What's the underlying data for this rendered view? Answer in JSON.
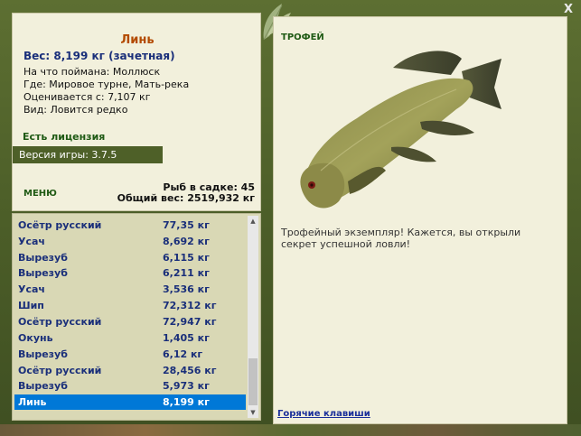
{
  "fish_card": {
    "name": "Линь",
    "weight_line": "Вес: 8,199 кг (зачетная)",
    "caught_on": "На что поймана: Моллюск",
    "location": "Где: Мировое турне, Мать-река",
    "valued_from": "Оценивается с: 7,107 кг",
    "kind": "Вид: Ловится редко",
    "license": "Есть лицензия",
    "version": "Версия игры: 3.7.5"
  },
  "menu": {
    "label": "МЕНЮ"
  },
  "keepnet": {
    "count_text": "Рыб в садке: 45",
    "total_text": "Общий вес: 2519,932 кг"
  },
  "catch_list": [
    {
      "name": "Осётр русский",
      "weight": "77,35 кг"
    },
    {
      "name": "Усач",
      "weight": "8,692 кг"
    },
    {
      "name": "Вырезуб",
      "weight": "6,115 кг"
    },
    {
      "name": "Вырезуб",
      "weight": "6,211 кг"
    },
    {
      "name": "Усач",
      "weight": "3,536 кг"
    },
    {
      "name": "Шип",
      "weight": "72,312 кг"
    },
    {
      "name": "Осётр русский",
      "weight": "72,947 кг"
    },
    {
      "name": "Окунь",
      "weight": "1,405 кг"
    },
    {
      "name": "Вырезуб",
      "weight": "6,12 кг"
    },
    {
      "name": "Осётр русский",
      "weight": "28,456 кг"
    },
    {
      "name": "Вырезуб",
      "weight": "5,973 кг"
    },
    {
      "name": "Линь",
      "weight": "8,199 кг",
      "selected": true
    }
  ],
  "trophy": {
    "label": "ТРОФЕЙ",
    "text": "Трофейный экземпляр! Кажется, вы открыли секрет успешной ловли!"
  },
  "footer": {
    "hotkeys": "Горячие клавиши"
  },
  "window": {
    "close": "X"
  },
  "colors": {
    "frame_green": "#4e6028",
    "panel_bg": "#f2f0dc",
    "list_bg": "#d9d8b5",
    "name_orange": "#b34a00",
    "text_blue": "#1a2f7a",
    "label_green": "#1f5a14",
    "selection_blue": "#0078d7"
  },
  "icons": [
    "leaf-decoration-icon",
    "close-icon",
    "scroll-up-icon",
    "scroll-down-icon",
    "tench-fish-image"
  ]
}
